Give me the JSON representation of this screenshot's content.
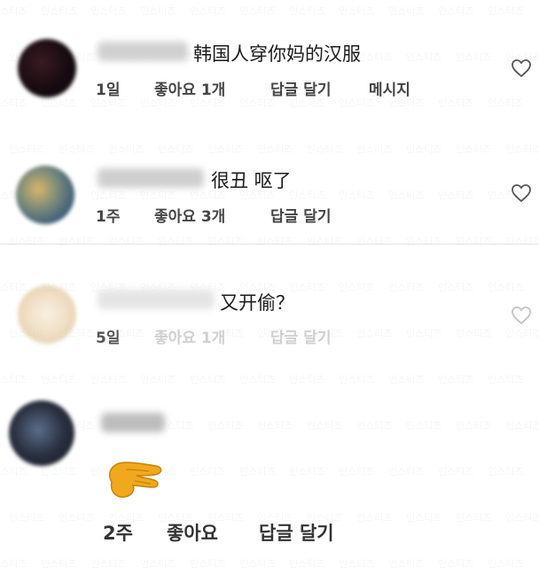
{
  "comments": [
    {
      "text": "韩国人穿你妈的汉服",
      "time": "1일",
      "likes": "좋아요 1개",
      "reply": "답글 달기",
      "message": "메시지"
    },
    {
      "text": "很丑 呕了",
      "time": "1주",
      "likes": "좋아요 3개",
      "reply": "답글 달기"
    },
    {
      "text": "又开偷？",
      "time": "5일",
      "likes": "좋아요 1개",
      "reply": "답글 달기"
    },
    {
      "emoji": "🤏",
      "time": "2주",
      "likes": "좋아요",
      "reply": "답글 달기"
    }
  ],
  "watermark": "인스티즈",
  "icons": {
    "like": "heart-outline-icon",
    "pinch": "pinching-hand-emoji"
  },
  "colors": {
    "text": "#1b1b1b",
    "meta": "#444444",
    "divider": "#e2e2e2",
    "heart": "#555555"
  }
}
